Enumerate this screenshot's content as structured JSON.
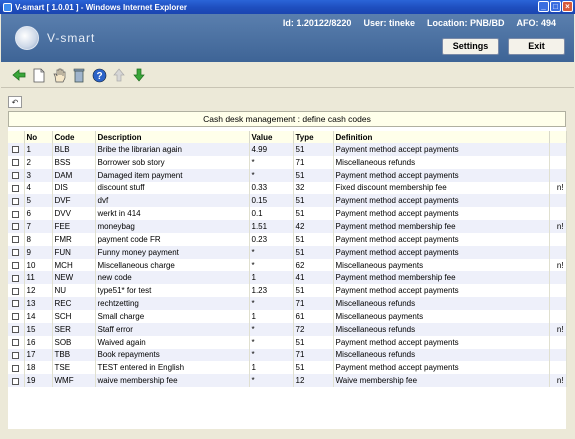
{
  "window": {
    "title": "V-smart [ 1.0.01 ] - Windows Internet Explorer"
  },
  "header": {
    "logo_text": "V-smart",
    "id": "Id: 1.20122/8220",
    "user": "User: tineke",
    "location": "Location: PNB/BD",
    "afo": "AFO: 494",
    "settings_label": "Settings",
    "exit_label": "Exit"
  },
  "toolbar": {
    "icons": [
      "back-arrow-icon",
      "new-document-icon",
      "select-hand-icon",
      "delete-bin-icon",
      "help-icon",
      "move-up-icon",
      "move-down-icon"
    ]
  },
  "panel": {
    "title": "Cash desk management : define cash codes",
    "columns": [
      "No",
      "Code",
      "Description",
      "Value",
      "Type",
      "Definition"
    ]
  },
  "rows": [
    {
      "no": "1",
      "code": "BLB",
      "desc": "Bribe the librarian again",
      "value": "4.99",
      "type": "51",
      "def": "Payment method accept payments",
      "note": ""
    },
    {
      "no": "2",
      "code": "BSS",
      "desc": "Borrower sob story",
      "value": "*",
      "type": "71",
      "def": "Miscellaneous refunds",
      "note": ""
    },
    {
      "no": "3",
      "code": "DAM",
      "desc": "Damaged item payment",
      "value": "*",
      "type": "51",
      "def": "Payment method accept payments",
      "note": ""
    },
    {
      "no": "4",
      "code": "DIS",
      "desc": "discount stuff",
      "value": "0.33",
      "type": "32",
      "def": "Fixed discount membership fee",
      "note": "n!"
    },
    {
      "no": "5",
      "code": "DVF",
      "desc": "dvf",
      "value": "0.15",
      "type": "51",
      "def": "Payment method accept payments",
      "note": ""
    },
    {
      "no": "6",
      "code": "DVV",
      "desc": "werkt in 414",
      "value": "0.1",
      "type": "51",
      "def": "Payment method accept payments",
      "note": ""
    },
    {
      "no": "7",
      "code": "FEE",
      "desc": "moneybag",
      "value": "1.51",
      "type": "42",
      "def": "Payment method membership fee",
      "note": "n!"
    },
    {
      "no": "8",
      "code": "FMR",
      "desc": "payment code FR",
      "value": "0.23",
      "type": "51",
      "def": "Payment method accept payments",
      "note": ""
    },
    {
      "no": "9",
      "code": "FUN",
      "desc": "Funny money payment",
      "value": "*",
      "type": "51",
      "def": "Payment method accept payments",
      "note": ""
    },
    {
      "no": "10",
      "code": "MCH",
      "desc": "Miscellaneous charge",
      "value": "*",
      "type": "62",
      "def": "Miscellaneous payments",
      "note": "n!"
    },
    {
      "no": "11",
      "code": "NEW",
      "desc": "new code",
      "value": "1",
      "type": "41",
      "def": "Payment method membership fee",
      "note": ""
    },
    {
      "no": "12",
      "code": "NU",
      "desc": "type51* for test",
      "value": "1.23",
      "type": "51",
      "def": "Payment method accept payments",
      "note": ""
    },
    {
      "no": "13",
      "code": "REC",
      "desc": "rechtzetting",
      "value": "*",
      "type": "71",
      "def": "Miscellaneous refunds",
      "note": ""
    },
    {
      "no": "14",
      "code": "SCH",
      "desc": "Small charge",
      "value": "1",
      "type": "61",
      "def": "Miscellaneous payments",
      "note": ""
    },
    {
      "no": "15",
      "code": "SER",
      "desc": "Staff error",
      "value": "*",
      "type": "72",
      "def": "Miscellaneous refunds",
      "note": "n!"
    },
    {
      "no": "16",
      "code": "SOB",
      "desc": "Waived again",
      "value": "*",
      "type": "51",
      "def": "Payment method accept payments",
      "note": ""
    },
    {
      "no": "17",
      "code": "TBB",
      "desc": "Book repayments",
      "value": "*",
      "type": "71",
      "def": "Miscellaneous refunds",
      "note": ""
    },
    {
      "no": "18",
      "code": "TSE",
      "desc": "TEST entered in English",
      "value": "1",
      "type": "51",
      "def": "Payment method accept payments",
      "note": ""
    },
    {
      "no": "19",
      "code": "WMF",
      "desc": "waive membership fee",
      "value": "*",
      "type": "12",
      "def": "Waive membership fee",
      "note": "n!"
    }
  ]
}
